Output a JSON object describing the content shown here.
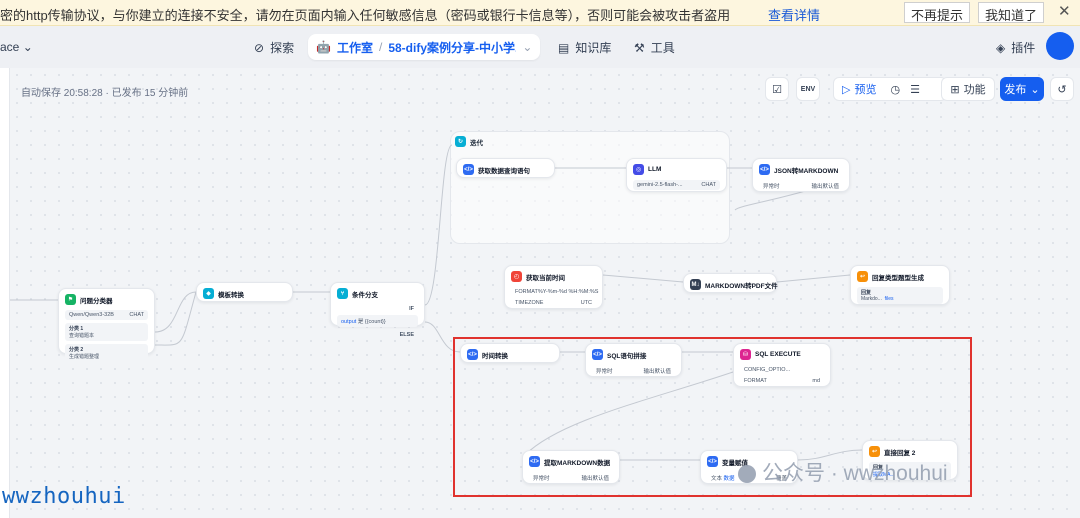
{
  "warning": {
    "message": "密的http传输协议，与你建立的连接不安全，请勿在页面内输入任何敏感信息（密码或银行卡信息等），否则可能会被攻击者盗用",
    "details_link": "查看详情",
    "dont_remind": "不再提示",
    "got_it": "我知道了",
    "close": "✕"
  },
  "nav": {
    "workspace": "ace",
    "explore": "探索",
    "studio": "工作室",
    "app_name": "58-dify案例分享-中小学...",
    "knowledge": "知识库",
    "tools": "工具",
    "plugins": "插件"
  },
  "canvas": {
    "autosave": "自动保存 20:58:28 · 已发布 15 分钟前"
  },
  "toolbar": {
    "preview": "预览",
    "features": "功能",
    "publish": "发布"
  },
  "nodes": {
    "classifier": {
      "title": "问题分类器",
      "model": "Qwen/Qwen3-32B",
      "model_tag": "CHAT",
      "class1_label": "分类 1",
      "class1": "查询错题本",
      "class2_label": "分类 2",
      "class2": "生成错题整理"
    },
    "template": {
      "title": "模板转换"
    },
    "ifelse": {
      "title": "条件分支",
      "if": "IF",
      "else": "ELSE",
      "cond_var": "output",
      "cond_op": "是",
      "cond_val": "{{count}}"
    },
    "iteration": {
      "title": "迭代"
    },
    "getquery": {
      "title": "获取数据查询语句"
    },
    "llm": {
      "title": "LLM",
      "model": "gemini-2.5-flash-...",
      "model_tag": "CHAT"
    },
    "json2md": {
      "title": "JSON转MARKDOWN",
      "exc_label": "异常时",
      "exc_value": "输出默认值"
    },
    "gettime": {
      "title": "获取当前时间",
      "format_label": "FORMAT",
      "format_value": "%Y-%m-%d %H:%M:%S",
      "tz_label": "TIMEZONE",
      "tz_value": "UTC"
    },
    "md2pdf": {
      "title": "MARKDOWN转PDF文件"
    },
    "answer1": {
      "title": "回复类型题型生成",
      "reply_label": "回复",
      "var1": "Markdo...",
      "var2": "files"
    },
    "timeconv": {
      "title": "时间转换"
    },
    "sqlbuild": {
      "title": "SQL语句拼接",
      "exc_label": "异常时",
      "exc_value": "输出默认值"
    },
    "sqlexec": {
      "title": "SQL EXECUTE",
      "config_label": "CONFIG_OPTIO...",
      "format_label": "FORMAT",
      "format_value": "md"
    },
    "extractmd": {
      "title": "提取MARKDOWN数据",
      "exc_label": "异常时",
      "exc_value": "输出默认值"
    },
    "varagg": {
      "title": "变量赋值",
      "row_text": "文本",
      "row_value": "数据",
      "row_tag": "覆盖"
    },
    "answer2": {
      "title": "直接回复 2",
      "reply_label": "回复",
      "var": "提取MA..."
    }
  },
  "watermarks": {
    "left": "wwzhouhui",
    "right": "公众号 · wwzhouhui"
  }
}
